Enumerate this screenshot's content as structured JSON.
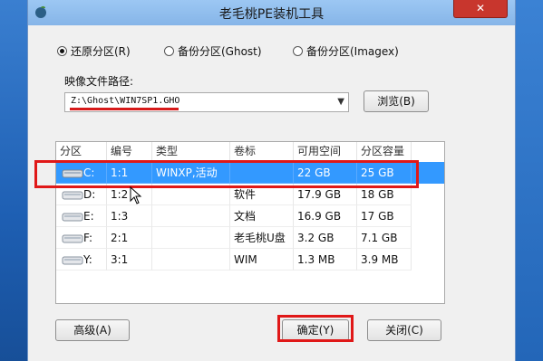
{
  "window": {
    "title": "老毛桃PE装机工具",
    "close_label": "✕"
  },
  "modes": [
    {
      "label": "还原分区(R)",
      "checked": true
    },
    {
      "label": "备份分区(Ghost)",
      "checked": false
    },
    {
      "label": "备份分区(Imagex)",
      "checked": false
    }
  ],
  "image_path": {
    "label": "映像文件路径:",
    "value": "Z:\\Ghost\\WIN7SP1.GHO",
    "browse_label": "浏览(B)"
  },
  "table": {
    "columns": [
      "分区",
      "编号",
      "类型",
      "卷标",
      "可用空间",
      "分区容量"
    ],
    "rows": [
      {
        "drive": "C:",
        "number": "1:1",
        "type": "WINXP,活动",
        "volume": "",
        "free": "22 GB",
        "capacity": "25 GB",
        "selected": true
      },
      {
        "drive": "D:",
        "number": "1:2",
        "type": "",
        "volume": "软件",
        "free": "17.9 GB",
        "capacity": "18 GB",
        "selected": false
      },
      {
        "drive": "E:",
        "number": "1:3",
        "type": "",
        "volume": "文档",
        "free": "16.9 GB",
        "capacity": "17 GB",
        "selected": false
      },
      {
        "drive": "F:",
        "number": "2:1",
        "type": "",
        "volume": "老毛桃U盘",
        "free": "3.2 GB",
        "capacity": "7.1 GB",
        "selected": false
      },
      {
        "drive": "Y:",
        "number": "3:1",
        "type": "",
        "volume": "WIM",
        "free": "1.3 MB",
        "capacity": "3.9 MB",
        "selected": false
      }
    ]
  },
  "buttons": {
    "advanced": "高级(A)",
    "ok": "确定(Y)",
    "close": "关闭(C)"
  },
  "colors": {
    "selection": "#3399ff",
    "annotation": "#e01818",
    "close_button": "#c8362d"
  }
}
